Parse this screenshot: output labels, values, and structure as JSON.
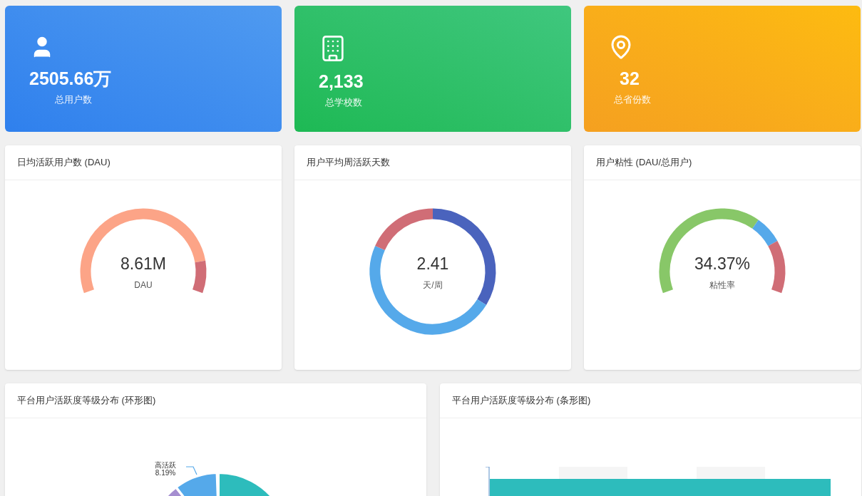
{
  "stats": [
    {
      "kind": "user",
      "value": "2505.66万",
      "label": "总用户数"
    },
    {
      "kind": "school",
      "value": "2,133",
      "label": "总学校数"
    },
    {
      "kind": "province",
      "value": "32",
      "label": "总省份数"
    }
  ],
  "gauges": [
    {
      "kind": "gauge_dau",
      "title": "日均活跃用户数 (DAU)",
      "value": "8.61M",
      "label": "DAU"
    },
    {
      "kind": "ring",
      "title": "用户平均周活跃天数",
      "value": "2.41",
      "label": "天/周"
    },
    {
      "kind": "gauge_stickiness",
      "title": "用户粘性 (DAU/总用户)",
      "value": "34.37%",
      "label": "粘性率"
    }
  ],
  "distribution": [
    {
      "kind": "donut",
      "title": "平台用户活跃度等级分布 (环形图)",
      "slice_label": "高活跃",
      "slice_value": "8.19%"
    },
    {
      "kind": "bars",
      "title": "平台用户活跃度等级分布 (条形图)"
    }
  ]
}
